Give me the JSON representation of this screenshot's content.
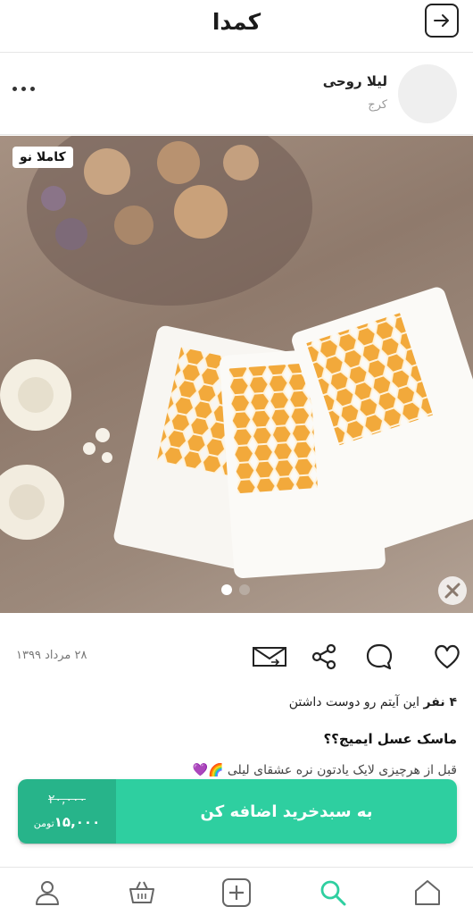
{
  "header": {
    "brand": "کمدا",
    "back_icon": "arrow-right-icon"
  },
  "seller": {
    "name": "لیلا روحی",
    "city": "کرج",
    "more_icon": "more-dots-icon"
  },
  "photo": {
    "badge": "کاملا نو",
    "slide_count": 2,
    "active_slide": 1,
    "colors": {
      "active_dot": "#ffffff",
      "inactive_dot": "#b8aca2"
    }
  },
  "actions": {
    "date": "۲۸ مرداد ۱۳۹۹",
    "icons": [
      "like-heart-icon",
      "comment-icon",
      "share-icon",
      "message-envelope-icon"
    ]
  },
  "likes": {
    "count": "۴ نفر",
    "text": "این آیتم رو دوست داشتن"
  },
  "post": {
    "title": "ماسک عسل ایمیج؟؟",
    "description": "قبل از هرچیزی لایک یادتون نره عشقای لیلی 🌈💜"
  },
  "cart": {
    "old_price": "۲۰,۰۰۰",
    "new_price": "۱۵,۰۰۰",
    "currency": "تومن",
    "add_label": "به سبدخرید اضافه کن",
    "colors": {
      "dark": "#27b48a",
      "light": "#2ecfa0"
    }
  },
  "bottom_nav": {
    "items": [
      "home-icon",
      "search-icon",
      "add-icon",
      "basket-icon",
      "profile-icon"
    ],
    "active": "search-icon",
    "colors": {
      "active": "#2ecfa0",
      "inactive": "#666666"
    }
  }
}
